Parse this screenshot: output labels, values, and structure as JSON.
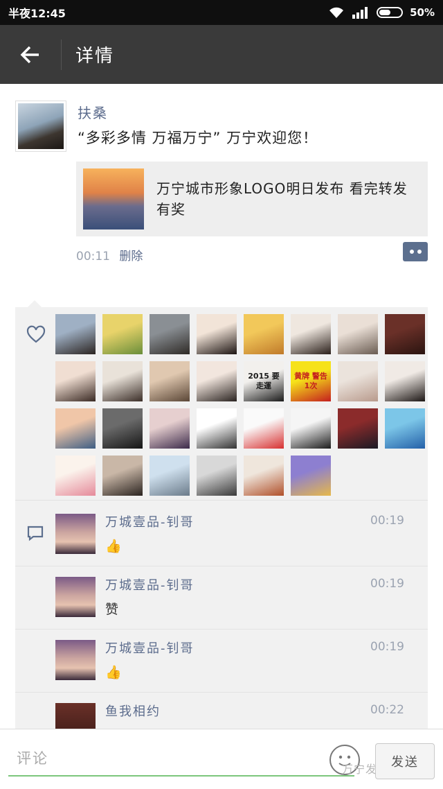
{
  "status_bar": {
    "time": "半夜12:45",
    "battery": "50%"
  },
  "title_bar": {
    "title": "详情"
  },
  "post": {
    "author": "扶桑",
    "text": "“多彩多情 万福万宁” 万宁欢迎您！",
    "link_title": "万宁城市形象LOGO明日发布 看完转发有奖",
    "time": "00:11",
    "delete_label": "删除"
  },
  "likes": {
    "avatar_colors": [
      [
        "#9fb0c4",
        "#2b2421"
      ],
      [
        "#e8d36a",
        "#6a8e3a"
      ],
      [
        "#8a8f94",
        "#2e2a26"
      ],
      [
        "#f2e4d8",
        "#1c1412"
      ],
      [
        "#f2c85a",
        "#c07a2a"
      ],
      [
        "#efe7df",
        "#2a1f1a"
      ],
      [
        "#eadfd6",
        "#6a5c52"
      ],
      [
        "#6a3028",
        "#2a1410"
      ],
      [
        "#f0ded2",
        "#3a2a24"
      ],
      [
        "#e9e2d9",
        "#3b2e28"
      ],
      [
        "#e0c8b0",
        "#5a4636"
      ],
      [
        "#f2e6de",
        "#2a2320"
      ],
      [
        "#f2f0ed",
        "#1a1a1a"
      ],
      [
        "#f6e21a",
        "#c41e1e"
      ],
      [
        "#ebe3dc",
        "#b89a8c"
      ],
      [
        "#f0eae5",
        "#1c1614"
      ],
      [
        "#f0c6a8",
        "#3e5e84"
      ],
      [
        "#6b6b6b",
        "#151515"
      ],
      [
        "#e6cfcf",
        "#3c2a4a"
      ],
      [
        "#ffffff",
        "#333333"
      ],
      [
        "#fafafa",
        "#d73030"
      ],
      [
        "#f5f5f5",
        "#1c1c1c"
      ],
      [
        "#8b2b2b",
        "#1a1a24"
      ],
      [
        "#7cc6e8",
        "#2460a8"
      ],
      [
        "#fbf3ec",
        "#e58a9a"
      ],
      [
        "#c9b7a7",
        "#2b2420"
      ],
      [
        "#cfe0ee",
        "#6b7b8a"
      ],
      [
        "#d8d8d8",
        "#3a3a3a"
      ],
      [
        "#efe6dc",
        "#b0502a"
      ],
      [
        "#8d7fd0",
        "#e6b84a"
      ]
    ],
    "special_labels": {
      "13": "黄牌 警告 1次",
      "12": "2015 要走運"
    }
  },
  "comments": [
    {
      "name": "万城壹品-钊哥",
      "time": "00:19",
      "body": "👍",
      "show_icon": true
    },
    {
      "name": "万城壹品-钊哥",
      "time": "00:19",
      "body": "赞",
      "show_icon": false
    },
    {
      "name": "万城壹品-钊哥",
      "time": "00:19",
      "body": "👍",
      "show_icon": false
    },
    {
      "name": "鱼我相约",
      "time": "00:22",
      "body": "",
      "show_icon": false
    }
  ],
  "input": {
    "placeholder": "评论",
    "send_label": "发送",
    "watermark": "万宁发布厅"
  }
}
